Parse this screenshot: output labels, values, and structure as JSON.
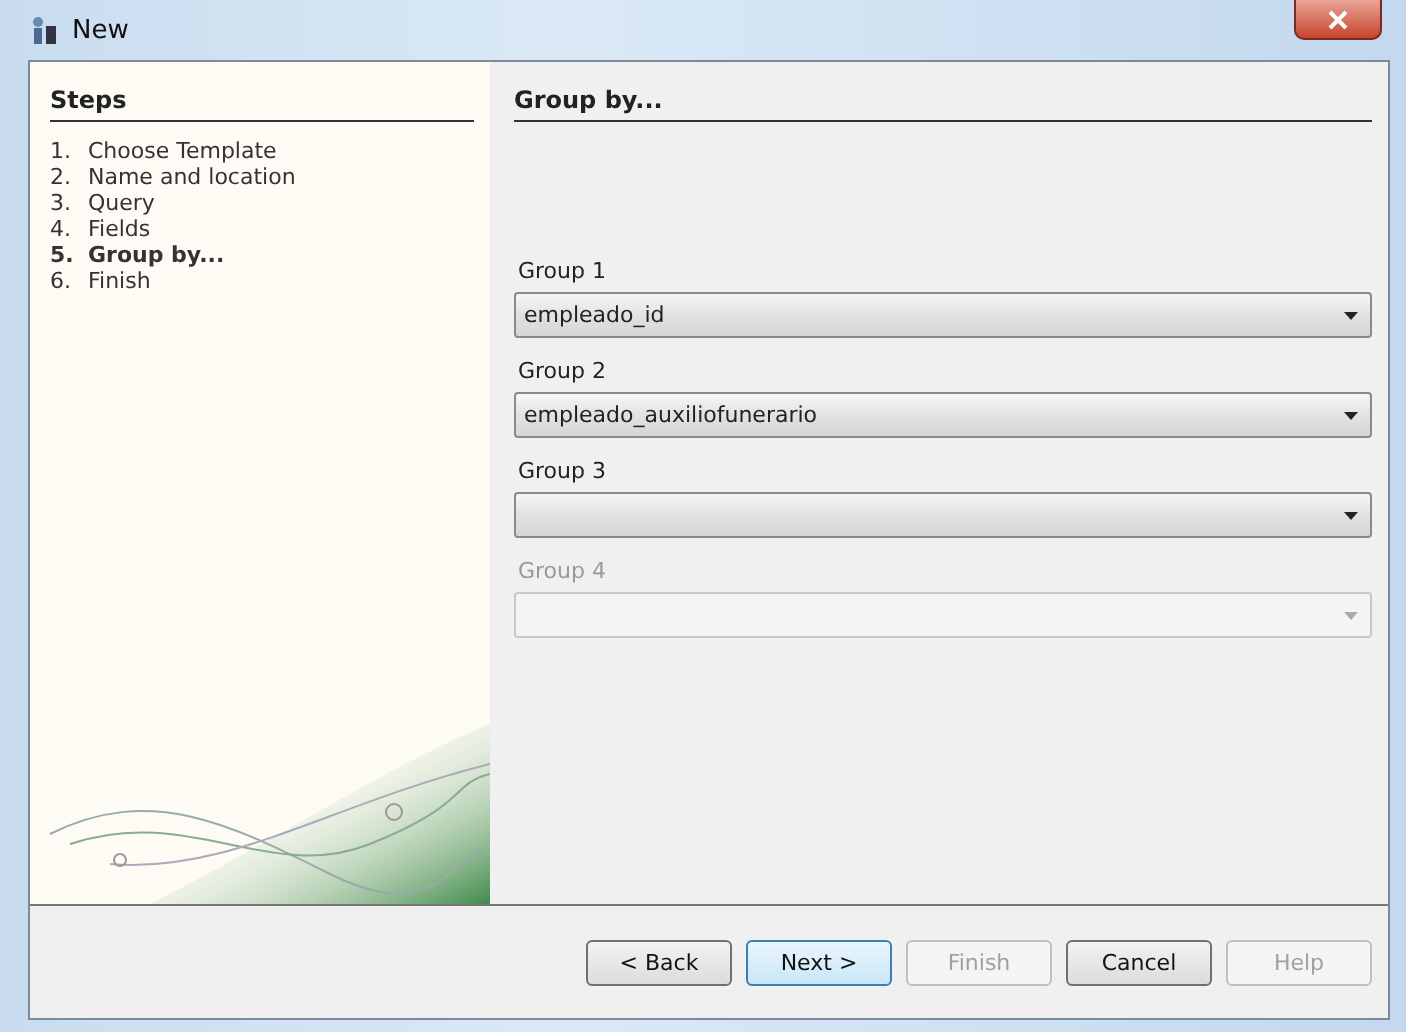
{
  "window": {
    "title": "New"
  },
  "steps": {
    "title": "Steps",
    "items": [
      {
        "number": "1.",
        "label": "Choose Template",
        "selected": false
      },
      {
        "number": "2.",
        "label": "Name and location",
        "selected": false
      },
      {
        "number": "3.",
        "label": "Query",
        "selected": false
      },
      {
        "number": "4.",
        "label": "Fields",
        "selected": false
      },
      {
        "number": "5.",
        "label": "Group by...",
        "selected": true
      },
      {
        "number": "6.",
        "label": "Finish",
        "selected": false
      }
    ]
  },
  "panel": {
    "title": "Group by...",
    "groups": [
      {
        "label": "Group 1",
        "value": "empleado_id",
        "disabled": false
      },
      {
        "label": "Group 2",
        "value": "empleado_auxiliofunerario",
        "disabled": false
      },
      {
        "label": "Group 3",
        "disabled": false
      },
      {
        "label": "Group 4",
        "disabled": true
      }
    ]
  },
  "buttons": [
    {
      "label": "< Back",
      "disabled": false,
      "focused": false
    },
    {
      "label": "Next >",
      "disabled": false,
      "focused": true
    },
    {
      "label": "Finish",
      "disabled": true,
      "focused": false
    },
    {
      "label": "Cancel",
      "disabled": false,
      "focused": false
    },
    {
      "label": "Help",
      "disabled": true,
      "focused": false
    }
  ]
}
